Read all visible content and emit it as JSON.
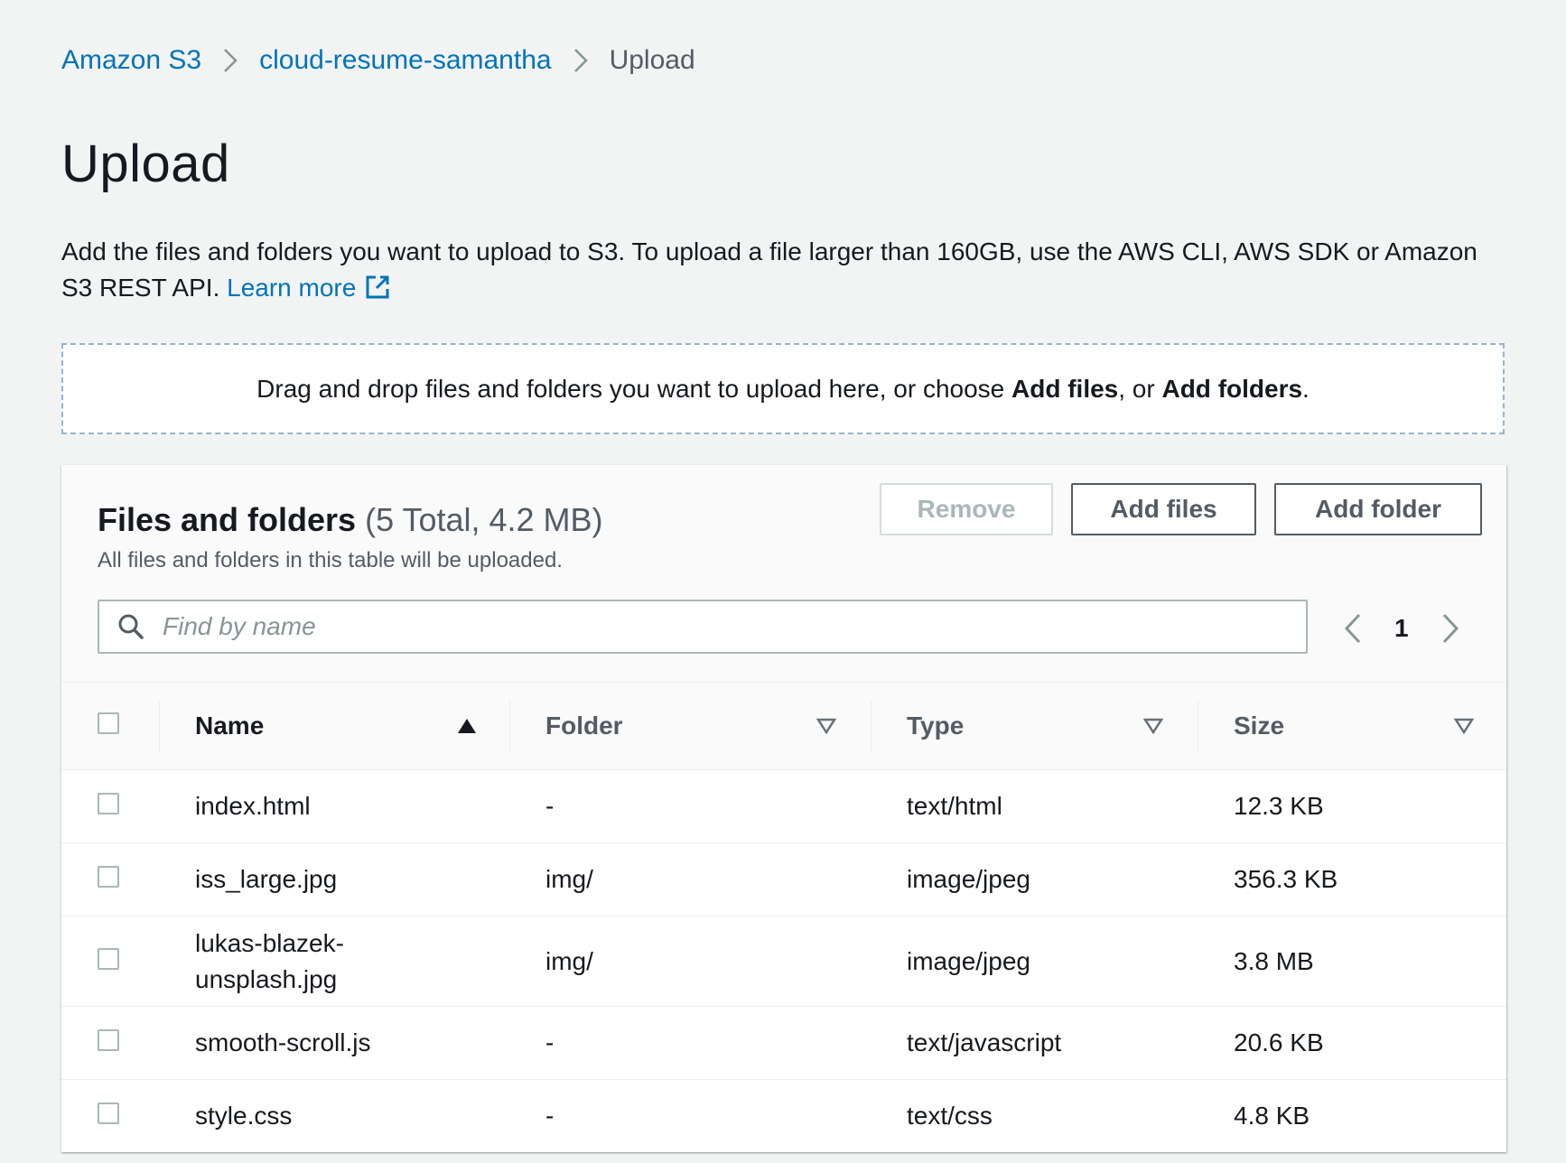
{
  "breadcrumb": {
    "items": [
      "Amazon S3",
      "cloud-resume-samantha"
    ],
    "current": "Upload"
  },
  "page": {
    "title": "Upload",
    "description": "Add the files and folders you want to upload to S3. To upload a file larger than 160GB, use the AWS CLI, AWS SDK or Amazon S3 REST API.",
    "learn_more": "Learn more"
  },
  "dropzone": {
    "prefix": "Drag and drop files and folders you want to upload here, or choose ",
    "add_files": "Add files",
    "middle": ", or ",
    "add_folders": "Add folders",
    "suffix": "."
  },
  "panel": {
    "title": "Files and folders",
    "count": "(5 Total, 4.2 MB)",
    "subtitle": "All files and folders in this table will be uploaded.",
    "remove_label": "Remove",
    "add_files_label": "Add files",
    "add_folder_label": "Add folder"
  },
  "search": {
    "placeholder": "Find by name",
    "value": ""
  },
  "pagination": {
    "current_page": "1"
  },
  "table": {
    "columns": [
      "Name",
      "Folder",
      "Type",
      "Size"
    ],
    "sort": {
      "column": "Name",
      "direction": "ascending"
    },
    "rows": [
      {
        "name": "index.html",
        "folder": "-",
        "type": "text/html",
        "size": "12.3 KB"
      },
      {
        "name": "iss_large.jpg",
        "folder": "img/",
        "type": "image/jpeg",
        "size": "356.3 KB"
      },
      {
        "name": "lukas-blazek-unsplash.jpg",
        "name_lines": [
          "lukas-blazek-",
          "unsplash.jpg"
        ],
        "folder": "img/",
        "type": "image/jpeg",
        "size": "3.8 MB"
      },
      {
        "name": "smooth-scroll.js",
        "folder": "-",
        "type": "text/javascript",
        "size": "20.6 KB"
      },
      {
        "name": "style.css",
        "folder": "-",
        "type": "text/css",
        "size": "4.8 KB"
      }
    ]
  },
  "colors": {
    "link": "#0073bb",
    "page_background": "#f2f3f3",
    "dropzone_border": "#8fb6d3",
    "text": "#16191f",
    "muted_text": "#545b64"
  },
  "icons": {
    "breadcrumb_separator": "chevron-right-icon",
    "learn_more": "external-link-icon",
    "search": "search-icon",
    "pager_prev": "chevron-left-icon",
    "pager_next": "chevron-right-icon",
    "sort_active": "sort-ascending-icon",
    "sort_inactive": "sort-down-outline-icon"
  }
}
